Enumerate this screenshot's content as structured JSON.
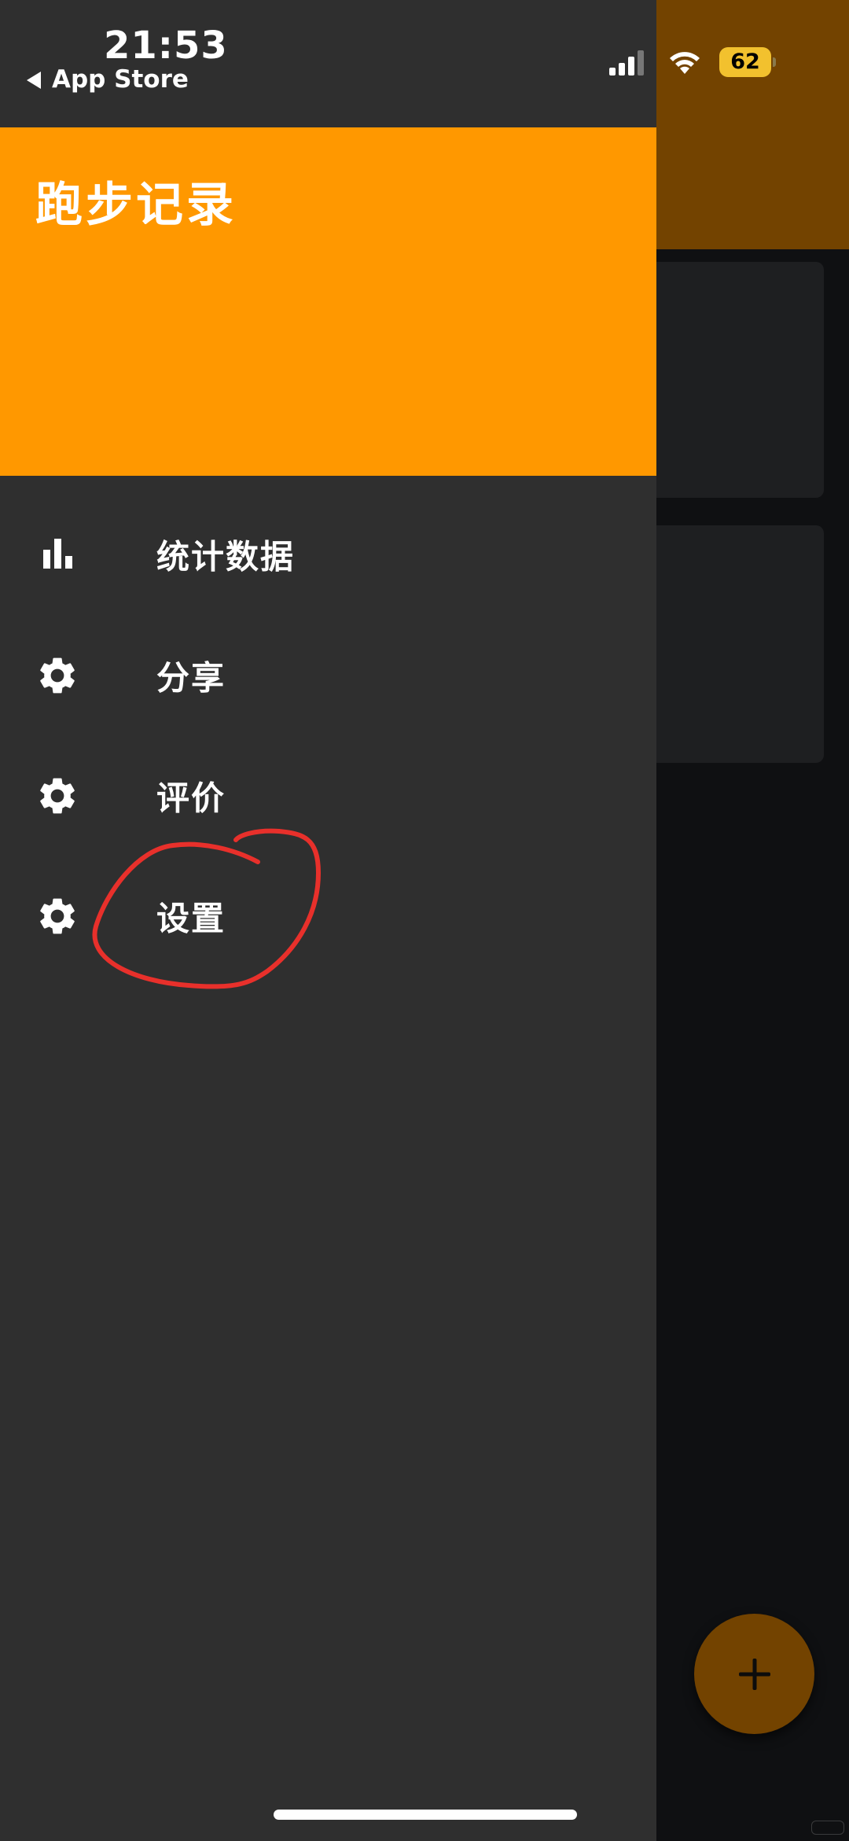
{
  "status_bar": {
    "time": "21:53",
    "back_label": "App Store",
    "battery": "62",
    "signal_icon": "cellular-signal-icon",
    "wifi_icon": "wifi-icon"
  },
  "drawer": {
    "title": "跑步记录",
    "header_color": "#ff9800",
    "background_color": "#2f2f2f",
    "items": [
      {
        "label": "统计数据",
        "icon": "bar-chart-icon"
      },
      {
        "label": "分享",
        "icon": "gear-icon"
      },
      {
        "label": "评价",
        "icon": "gear-icon"
      },
      {
        "label": "设置",
        "icon": "gear-icon"
      }
    ],
    "annotation": {
      "type": "hand-drawn circle",
      "target": "设置",
      "color": "#e8302b"
    }
  },
  "background_app": {
    "appbar_color": "#734300",
    "fab": {
      "icon": "plus-icon",
      "color": "#734300"
    }
  }
}
